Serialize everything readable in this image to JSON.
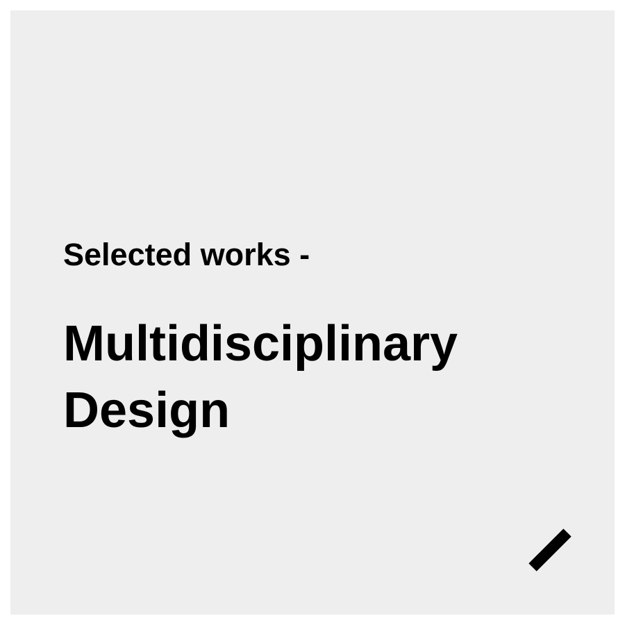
{
  "card": {
    "background_color": "#eeeeee",
    "subtitle": "Selected works -",
    "title_line_1": "Multidisciplinary",
    "title_line_2": "Design",
    "text_color": "#000000",
    "decoration_icon": "diagonal-slash-icon"
  }
}
